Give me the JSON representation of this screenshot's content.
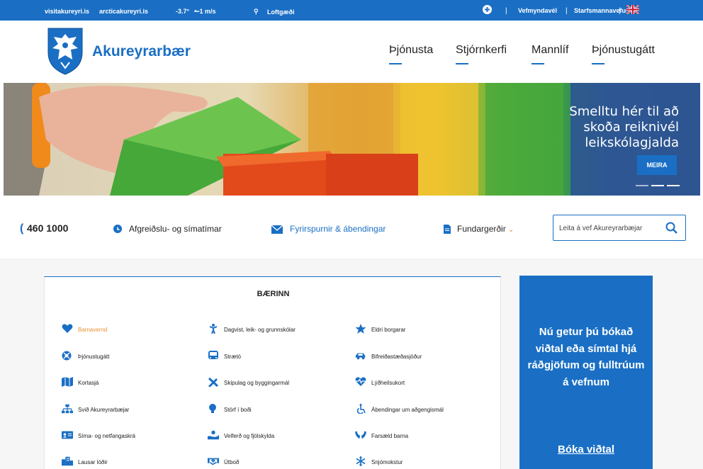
{
  "topbar": {
    "link1": "visitakureyri.is",
    "link2": "arcticakureyri.is",
    "temperature": "-3.7°",
    "wind": "↼1 m/s",
    "loftgaedi": "Loftgæði",
    "vefmyndavel": "Vefmyndavél",
    "starfsmannavefur": "Starfsmannavefur",
    "separator": "|"
  },
  "header": {
    "logo_text": "Akureyrarbær",
    "nav": [
      "Þjónusta",
      "Stjórnkerfi",
      "Mannlíf",
      "Þjónustugátt"
    ]
  },
  "banner": {
    "title": "Smelltu hér til að skoða reiknivél leikskólagjalda",
    "button": "MEIRA"
  },
  "contact": {
    "phone": "460 1000",
    "hours": "Afgreiðslu- og símatímar",
    "inquiries": "Fyrirspurnir & ábendingar",
    "minutes": "Fundargerðir",
    "search_placeholder": "Leita á vef Akureyrarbæjar"
  },
  "section": {
    "title": "BÆRINN",
    "services": [
      {
        "label": "Barnavernd",
        "icon": "heart-icon"
      },
      {
        "label": "Dagvist, leik- og grunnskólar",
        "icon": "child-icon"
      },
      {
        "label": "Eldri borgarar",
        "icon": "star-icon"
      },
      {
        "label": "Þjónustugátt",
        "icon": "lifebuoy-icon"
      },
      {
        "label": "Strætó",
        "icon": "bus-icon"
      },
      {
        "label": "Bifreiðastæðasjóður",
        "icon": "car-icon"
      },
      {
        "label": "Kortasjá",
        "icon": "map-icon"
      },
      {
        "label": "Skipulag og byggingarmál",
        "icon": "tools-icon"
      },
      {
        "label": "Lýðheilsukort",
        "icon": "heartbeat-icon"
      },
      {
        "label": "Svið Akureyrarbæjar",
        "icon": "org-chart-icon"
      },
      {
        "label": "Störf í boði",
        "icon": "lightbulb-icon"
      },
      {
        "label": "Ábendingar um aðgengismál",
        "icon": "wheelchair-icon"
      },
      {
        "label": "Síma- og netfangaskrá",
        "icon": "id-card-icon"
      },
      {
        "label": "Velferð og fjölskylda",
        "icon": "hand-care-icon"
      },
      {
        "label": "Farsæld barna",
        "icon": "hands-icon"
      },
      {
        "label": "Lausar lóðir",
        "icon": "buildings-icon"
      },
      {
        "label": "Útboð",
        "icon": "handshake-icon"
      },
      {
        "label": "Snjómokstur",
        "icon": "snowflake-icon"
      }
    ]
  },
  "promo": {
    "text": "Nú getur þú bókað viðtal eða símtal hjá ráðgjöfum og fulltrúum á vefnum",
    "link": "Bóka viðtal"
  },
  "colors": {
    "brand": "#1a6fc4",
    "accent": "#e8912f"
  }
}
